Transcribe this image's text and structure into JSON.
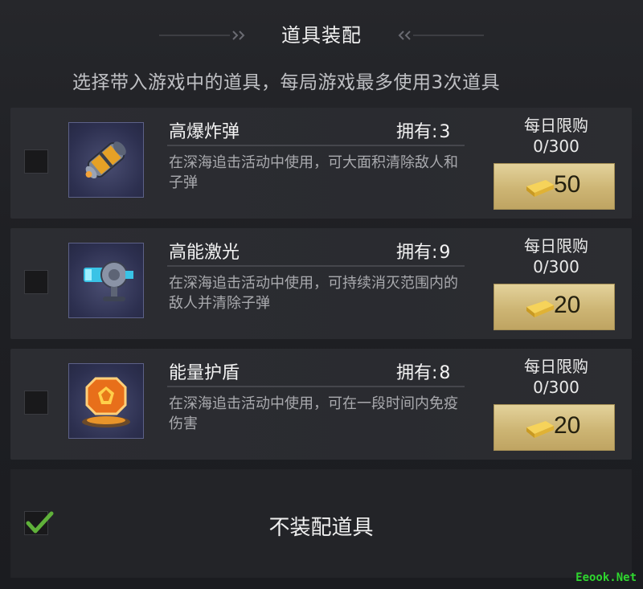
{
  "header": {
    "title": "道具装配"
  },
  "subtitle": "选择带入游戏中的道具，每局游戏最多使用3次道具",
  "owned_label": "拥有:",
  "limit_label": "每日限购",
  "items": [
    {
      "name": "高爆炸弹",
      "owned": "3",
      "desc": "在深海追击活动中使用，可大面积清除敌人和子弹",
      "limit": "0/300",
      "price": "50",
      "icon": "bomb-icon",
      "checked": false
    },
    {
      "name": "高能激光",
      "owned": "9",
      "desc": "在深海追击活动中使用，可持续消灭范围内的敌人并清除子弹",
      "limit": "0/300",
      "price": "20",
      "icon": "laser-icon",
      "checked": false
    },
    {
      "name": "能量护盾",
      "owned": "8",
      "desc": "在深海追击活动中使用，可在一段时间内免疫伤害",
      "limit": "0/300",
      "price": "20",
      "icon": "shield-icon",
      "checked": false
    }
  ],
  "no_item": {
    "label": "不装配道具",
    "checked": true
  },
  "watermark": "Eeook.Net",
  "colors": {
    "check": "#5fb13a",
    "gold_button": "#d8c488",
    "panel": "#2c2d32"
  }
}
